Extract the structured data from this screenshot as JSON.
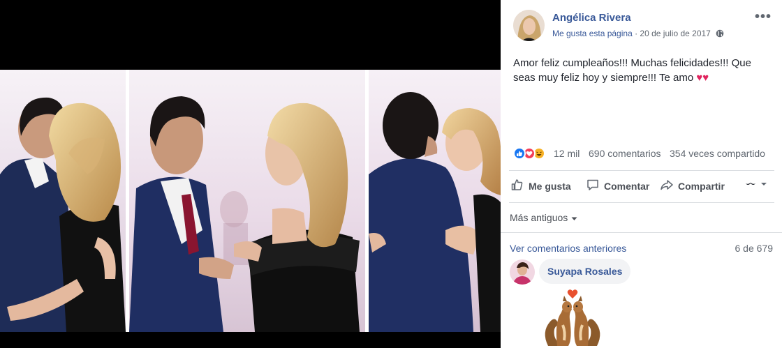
{
  "post": {
    "author": "Angélica Rivera",
    "like_page_label": "Me gusta esta página",
    "separator": " · ",
    "date": "20 de julio de 2017",
    "more_label": "•••",
    "text_line1": "Amor feliz cumpleaños!!! Muchas felicidades!!! Que",
    "text_line2": "seas muy feliz hoy y siempre!!! Te amo",
    "hearts": "♥♥"
  },
  "reactions": {
    "icons": [
      "like-icon",
      "love-icon",
      "haha-icon"
    ],
    "count": "12 mil",
    "comments": "690 comentarios",
    "shares": "354 veces compartido"
  },
  "actions": {
    "like": "Me gusta",
    "comment": "Comentar",
    "share": "Compartir"
  },
  "comments": {
    "sort_label": "Más antiguos",
    "view_previous": "Ver comentarios anteriores",
    "pager": "6 de 679",
    "items": [
      {
        "author": "Suyapa Rosales",
        "content": "sticker"
      }
    ]
  },
  "colors": {
    "link_blue": "#385898",
    "secondary_text": "#606770",
    "like_blue": "#1877f2",
    "love_red": "#f33e58",
    "haha_yellow": "#f7b125"
  }
}
